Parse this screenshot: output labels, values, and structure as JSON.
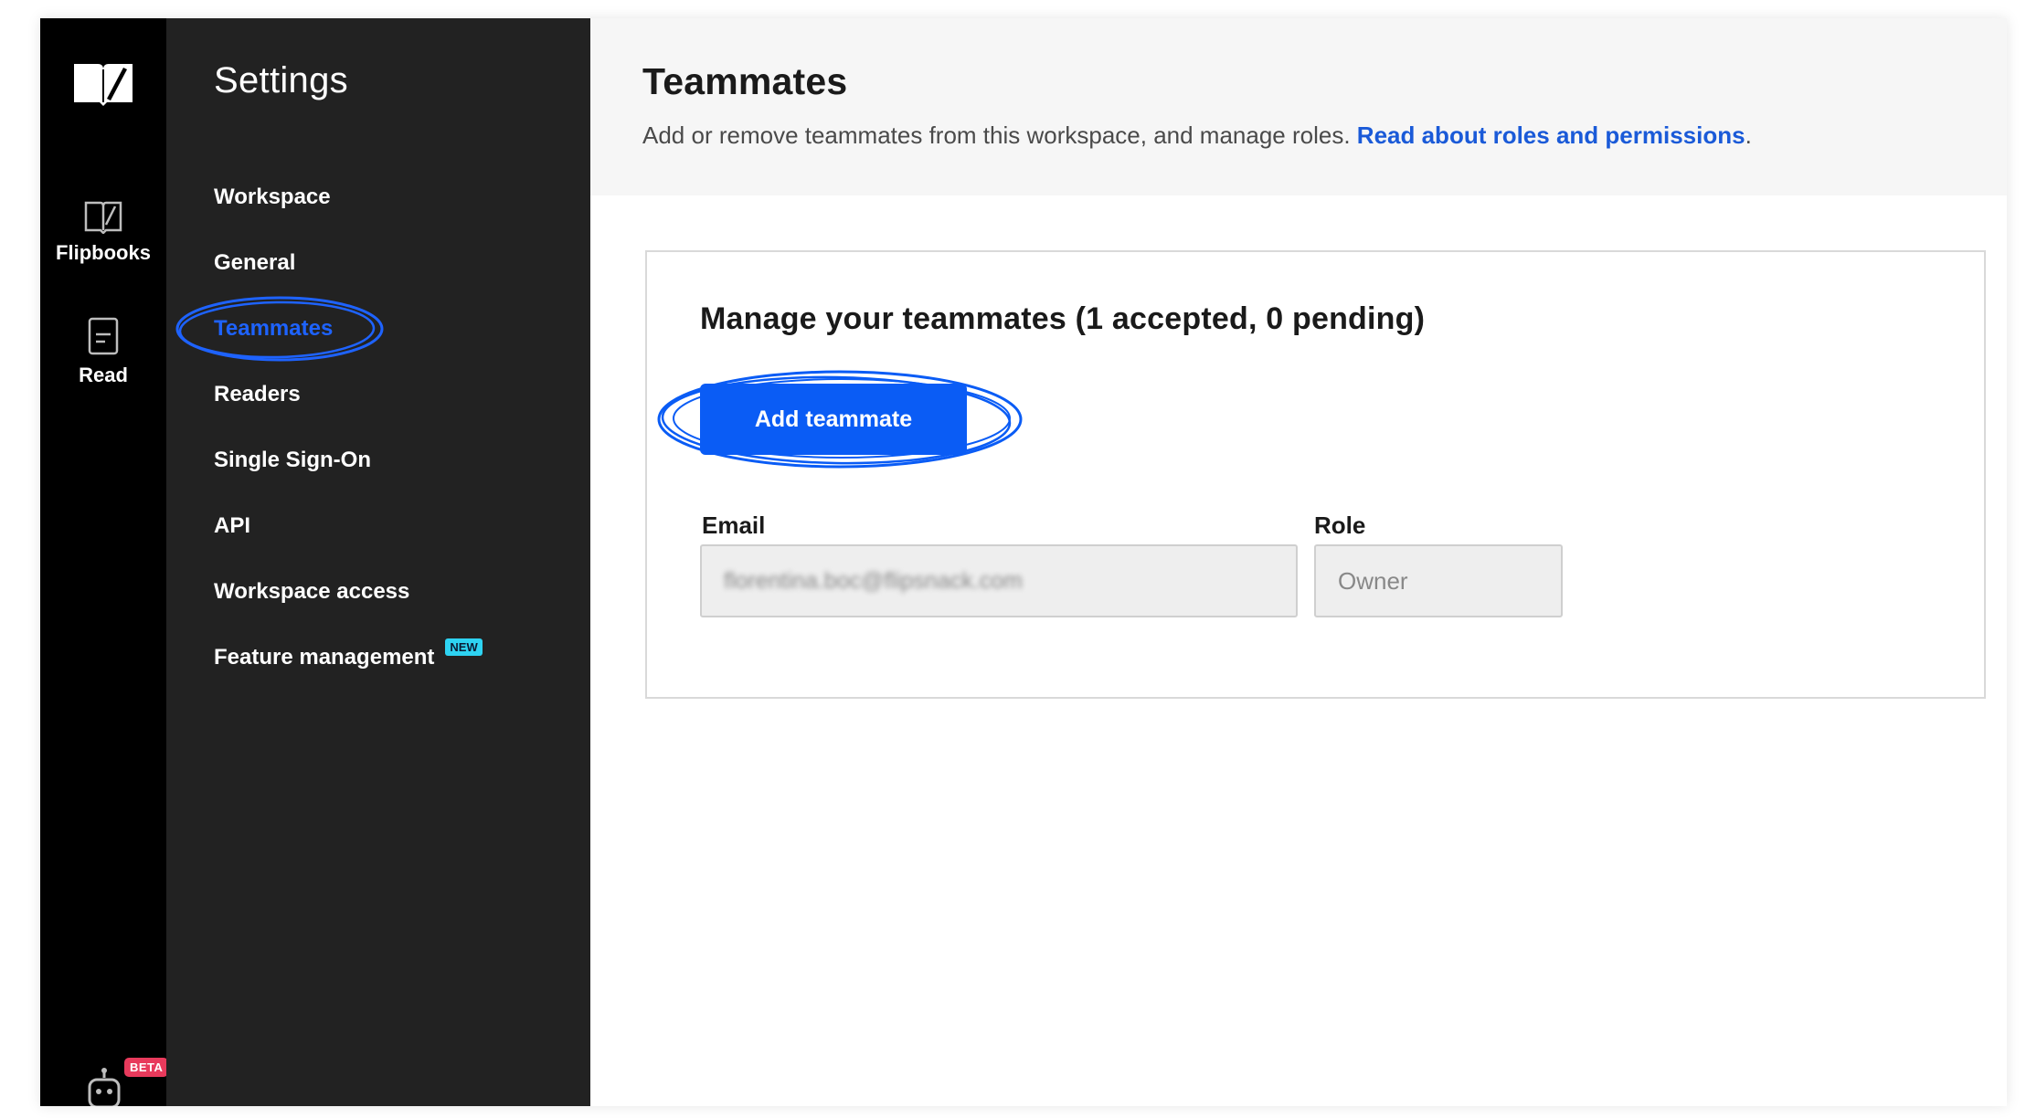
{
  "rail": {
    "items": [
      {
        "label": "Flipbooks",
        "icon": "flipbook-icon"
      },
      {
        "label": "Read",
        "icon": "read-icon"
      }
    ],
    "beta_badge": "BETA"
  },
  "sidebar": {
    "title": "Settings",
    "items": [
      {
        "label": "Workspace"
      },
      {
        "label": "General"
      },
      {
        "label": "Teammates",
        "active": true
      },
      {
        "label": "Readers"
      },
      {
        "label": "Single Sign-On"
      },
      {
        "label": "API"
      },
      {
        "label": "Workspace access"
      },
      {
        "label": "Feature management",
        "badge": "NEW"
      }
    ]
  },
  "header": {
    "title": "Teammates",
    "description": "Add or remove teammates from this workspace, and manage roles. ",
    "link_text": "Read about roles and permissions",
    "period": "."
  },
  "card": {
    "heading": "Manage your teammates (1 accepted, 0 pending)",
    "add_button": "Add teammate",
    "email_label": "Email",
    "email_value": "florentina.boc@flipsnack.com",
    "role_label": "Role",
    "role_value": "Owner"
  },
  "colors": {
    "accent": "#0a5cf5",
    "link": "#1a5ad8",
    "active_nav": "#1e63ff",
    "rail_bg": "#000000",
    "sidebar_bg": "#222222",
    "beta": "#e83a5c",
    "new": "#2ed3f2"
  }
}
